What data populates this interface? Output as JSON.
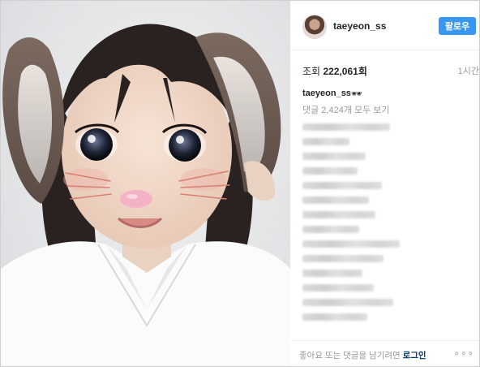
{
  "post": {
    "username": "taeyeon_ss",
    "follow_label": "팔로우",
    "views_label": "조회",
    "views_count": "222,061회",
    "time_ago": "1시간",
    "caption_username": "taeyeon_ss",
    "caption_emoji": "🕶",
    "view_all_comments": "댓글 2,424개 모두 보기",
    "login_prompt": "좋아요 또는 댓글을 남기려면",
    "login_link": "로그인",
    "more_options": "∘∘∘"
  },
  "colors": {
    "follow_button": "#3897f0",
    "link": "#003569",
    "muted_text": "#999999"
  },
  "icons": {
    "more": "more-options-icon",
    "avatar": "profile-avatar"
  }
}
